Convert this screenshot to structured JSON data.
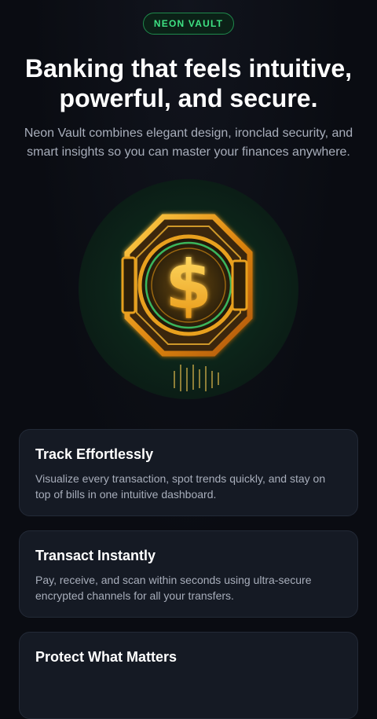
{
  "badge": {
    "label": "NEON VAULT"
  },
  "hero": {
    "headline": "Banking that feels intuitive, powerful, and secure.",
    "subheadline": "Neon Vault combines elegant design, ironclad security, and smart insights so you can master your finances anywhere.",
    "illustration_icon": "dollar-coin-icon"
  },
  "features": [
    {
      "title": "Track Effortlessly",
      "description": "Visualize every transaction, spot trends quickly, and stay on top of bills in one intuitive dashboard."
    },
    {
      "title": "Transact Instantly",
      "description": "Pay, receive, and scan within seconds using ultra-secure encrypted channels for all your transfers."
    },
    {
      "title": "Protect What Matters",
      "description": ""
    }
  ],
  "colors": {
    "background": "#0a0c12",
    "accent_green": "#3ee283",
    "coin_gold": "#f2a51c",
    "card_background": "#151a24"
  }
}
